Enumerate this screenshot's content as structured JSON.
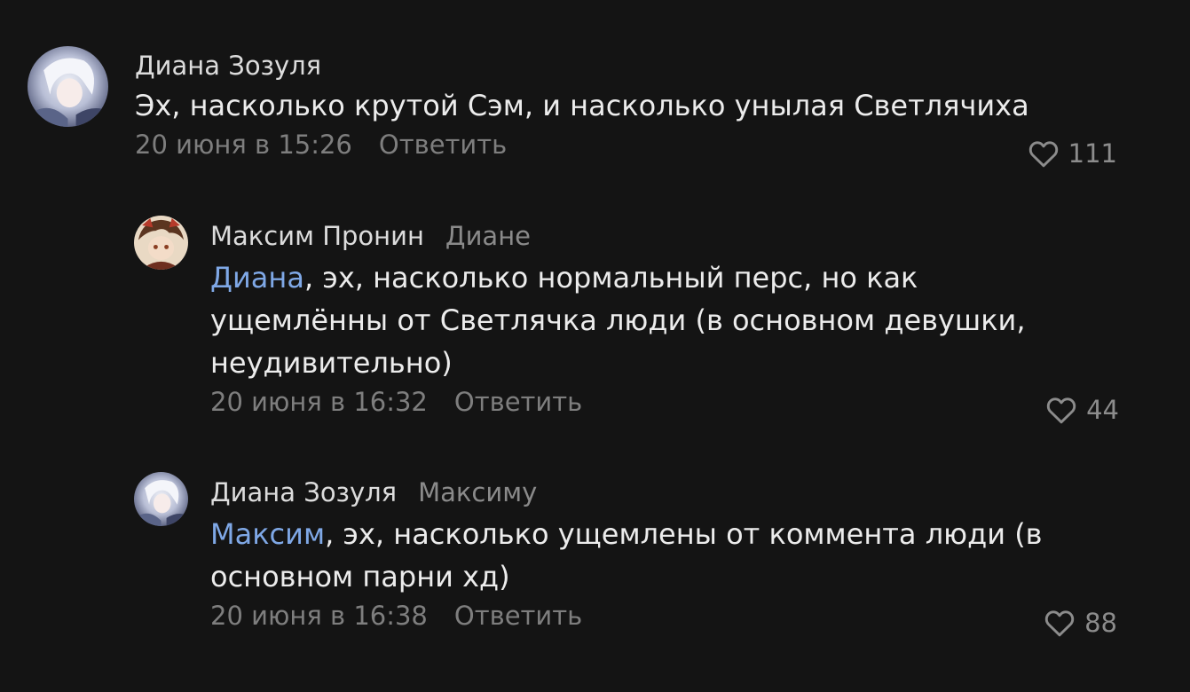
{
  "comments": [
    {
      "author": "Диана Зозуля",
      "reply_to": "",
      "mention": "",
      "text": "Эх, насколько крутой Сэм, и насколько унылая Светлячиха",
      "date": "20 июня в 15:26",
      "reply_label": "Ответить",
      "likes": "111",
      "avatar_icon": "avatar-photo-anime-white-hair"
    },
    {
      "author": "Максим Пронин",
      "reply_to": "Диане",
      "mention": "Диана",
      "text": ", эх, насколько нормальный перс, но как ущемлённы от Светлячка люди (в основном девушки, неудивительно)",
      "date": "20 июня в 16:32",
      "reply_label": "Ответить",
      "likes": "44",
      "avatar_icon": "avatar-photo-anime-brown-hair"
    },
    {
      "author": "Диана Зозуля",
      "reply_to": "Максиму",
      "mention": "Максим",
      "text": ", эх, насколько ущемлены от коммента люди (в основном парни хд)",
      "date": "20 июня в 16:38",
      "reply_label": "Ответить",
      "likes": "88",
      "avatar_icon": "avatar-photo-anime-white-hair"
    }
  ],
  "colors": {
    "background": "#141414",
    "mention": "#7fa8e6",
    "meta": "#7e7e7e"
  },
  "icons": {
    "like": "heart-outline-icon"
  }
}
